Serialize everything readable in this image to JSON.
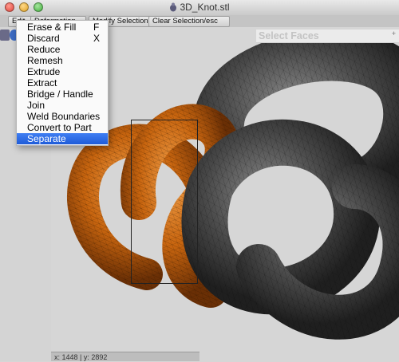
{
  "window": {
    "title": "3D_Knot.stl"
  },
  "toolbar": {
    "edit_label": "Edit",
    "deform_label": "Deformation",
    "modify_selection_label": "Modify Selection",
    "clear_selection_label": "Clear Selection/esc"
  },
  "edit_menu": {
    "items": [
      {
        "label": "Erase & Fill",
        "shortcut": "F"
      },
      {
        "label": "Discard",
        "shortcut": "X"
      },
      {
        "label": "Reduce",
        "shortcut": ""
      },
      {
        "label": "Remesh",
        "shortcut": ""
      },
      {
        "label": "Extrude",
        "shortcut": ""
      },
      {
        "label": "Extract",
        "shortcut": ""
      },
      {
        "label": "Bridge / Handle",
        "shortcut": ""
      },
      {
        "label": "Join",
        "shortcut": ""
      },
      {
        "label": "Weld Boundaries",
        "shortcut": ""
      },
      {
        "label": "Convert to Part",
        "shortcut": ""
      },
      {
        "label": "Separate",
        "shortcut": ""
      }
    ],
    "highlighted_item": "Separate"
  },
  "select_panel": {
    "title": "Select Faces"
  },
  "status": {
    "coords": "x: 1448 | y: 2892"
  },
  "colors": {
    "selection": "#c8650f",
    "mesh": "#3a3a3a",
    "highlight": "#2a66e4"
  }
}
